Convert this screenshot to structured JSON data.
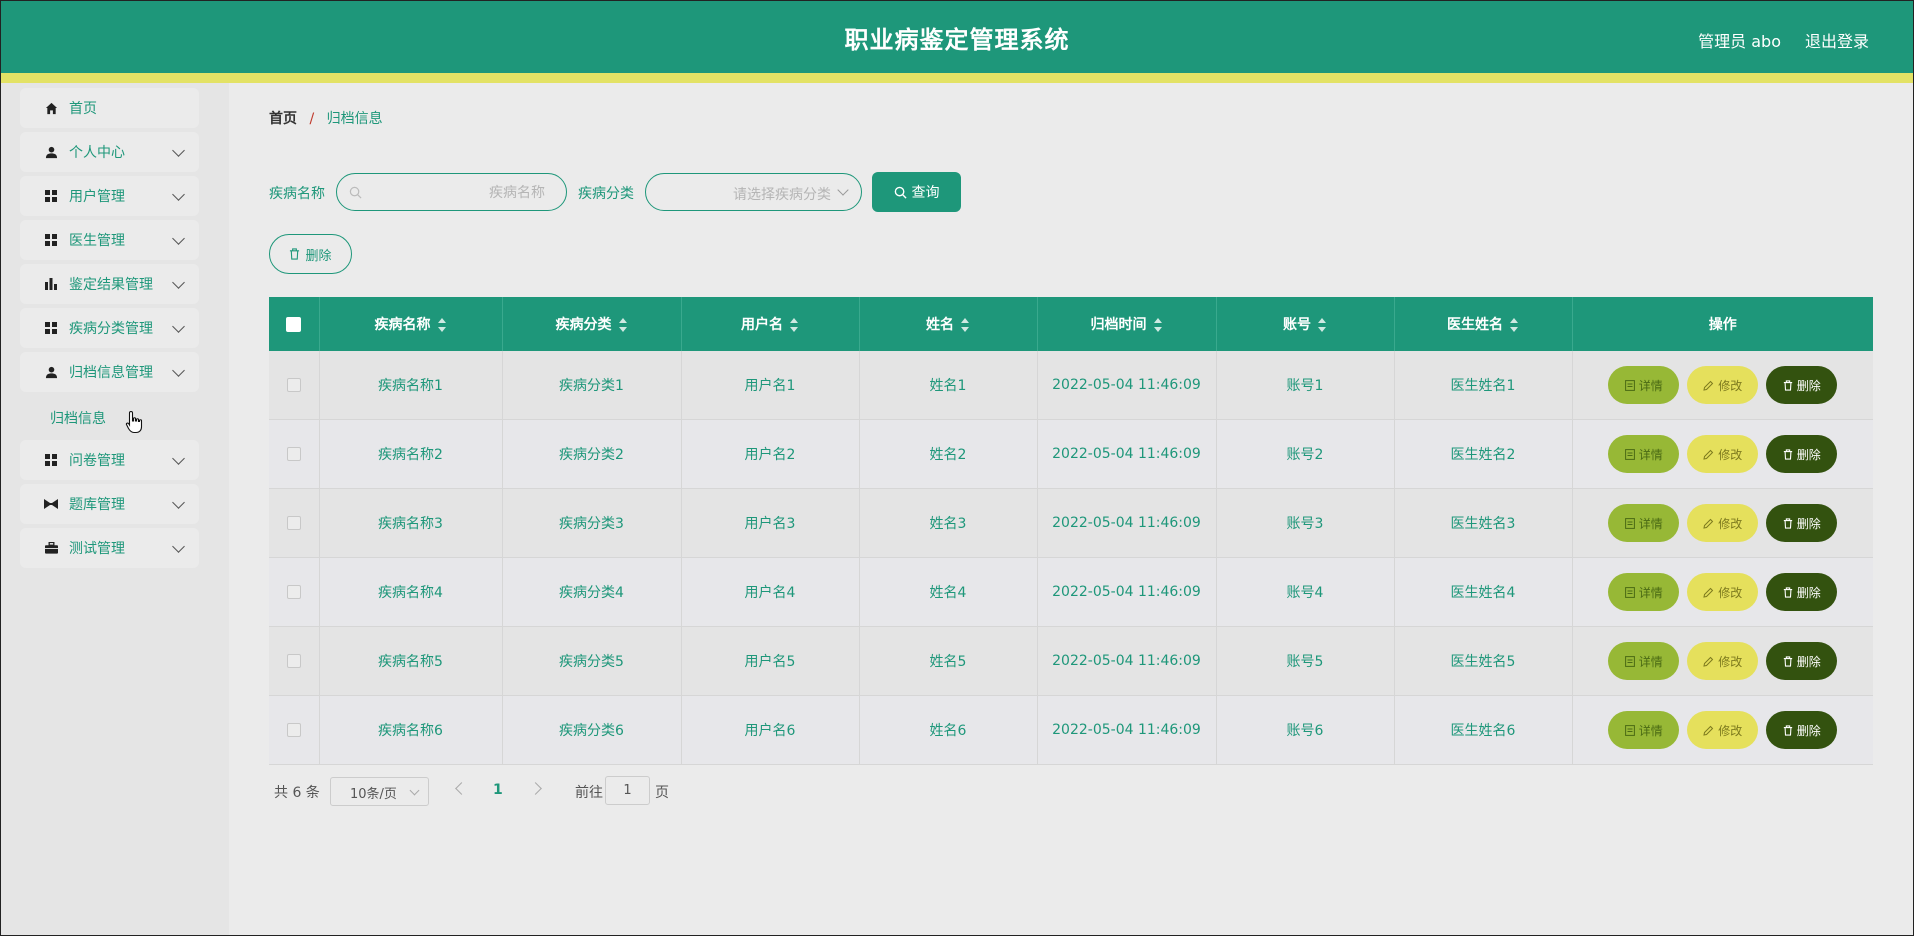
{
  "header": {
    "title": "职业病鉴定管理系统",
    "admin": "管理员 abo",
    "logout": "退出登录"
  },
  "colors": {
    "primary": "#1e977a",
    "accent_bar": "#e3e265",
    "detail": "#97b836",
    "edit": "#e5e05c",
    "delete": "#33520f"
  },
  "sidebar": {
    "items": [
      {
        "label": "首页",
        "icon": "home-icon"
      },
      {
        "label": "个人中心",
        "icon": "user-icon"
      },
      {
        "label": "用户管理",
        "icon": "grid-icon"
      },
      {
        "label": "医生管理",
        "icon": "grid-icon"
      },
      {
        "label": "鉴定结果管理",
        "icon": "bar-chart-icon"
      },
      {
        "label": "疾病分类管理",
        "icon": "grid-icon"
      },
      {
        "label": "归档信息管理",
        "icon": "user-icon"
      },
      {
        "label": "问卷管理",
        "icon": "grid-icon"
      },
      {
        "label": "题库管理",
        "icon": "bowtie-icon"
      },
      {
        "label": "测试管理",
        "icon": "briefcase-icon"
      }
    ],
    "sub_item": "归档信息"
  },
  "breadcrumb": {
    "home": "首页",
    "sep": "/",
    "current": "归档信息"
  },
  "search": {
    "disease_label": "疾病名称",
    "disease_placeholder": "疾病名称",
    "category_label": "疾病分类",
    "category_placeholder": "请选择疾病分类",
    "query_btn": "查询",
    "delete_btn": "删除"
  },
  "table": {
    "columns": [
      "疾病名称",
      "疾病分类",
      "用户名",
      "姓名",
      "归档时间",
      "账号",
      "医生姓名",
      "操作"
    ],
    "rows": [
      [
        "疾病名称1",
        "疾病分类1",
        "用户名1",
        "姓名1",
        "2022-05-04 11:46:09",
        "账号1",
        "医生姓名1"
      ],
      [
        "疾病名称2",
        "疾病分类2",
        "用户名2",
        "姓名2",
        "2022-05-04 11:46:09",
        "账号2",
        "医生姓名2"
      ],
      [
        "疾病名称3",
        "疾病分类3",
        "用户名3",
        "姓名3",
        "2022-05-04 11:46:09",
        "账号3",
        "医生姓名3"
      ],
      [
        "疾病名称4",
        "疾病分类4",
        "用户名4",
        "姓名4",
        "2022-05-04 11:46:09",
        "账号4",
        "医生姓名4"
      ],
      [
        "疾病名称5",
        "疾病分类5",
        "用户名5",
        "姓名5",
        "2022-05-04 11:46:09",
        "账号5",
        "医生姓名5"
      ],
      [
        "疾病名称6",
        "疾病分类6",
        "用户名6",
        "姓名6",
        "2022-05-04 11:46:09",
        "账号6",
        "医生姓名6"
      ]
    ],
    "actions": {
      "detail": "详情",
      "edit": "修改",
      "delete": "删除"
    }
  },
  "pagination": {
    "total": "共 6 条",
    "page_size": "10条/页",
    "current_page": "1",
    "goto": "前往",
    "goto_value": "1",
    "page_suffix": "页"
  }
}
